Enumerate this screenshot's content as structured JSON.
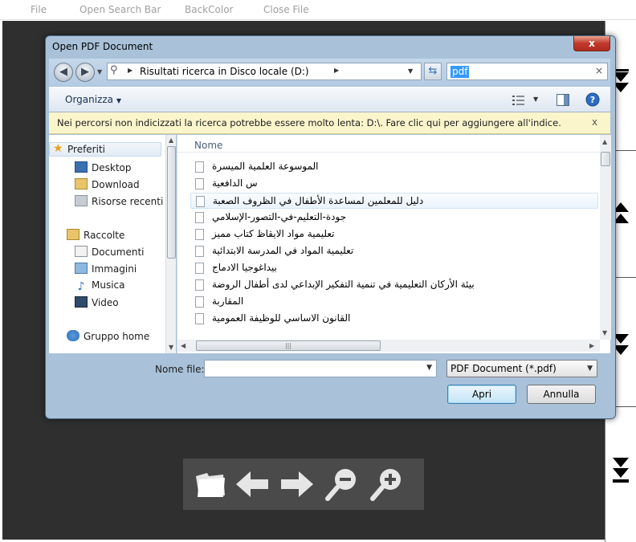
{
  "menu": {
    "items": [
      "File",
      "Open Search Bar",
      "BackColor",
      "Close File"
    ]
  },
  "dialog": {
    "title": "Open PDF Document",
    "close_label": "x",
    "address": "Risultati ricerca in Disco locale (D:)",
    "search_value": "pdf",
    "organize_label": "Organizza",
    "info_text": "Nei percorsi non indicizzati la ricerca potrebbe essere molto lenta: D:\\. Fare clic qui per aggiungere all'indice.",
    "info_close": "x",
    "nav": {
      "favorites": "Preferiti",
      "desktop": "Desktop",
      "download": "Download",
      "recent": "Risorse recenti",
      "libraries": "Raccolte",
      "documents": "Documenti",
      "images": "Immagini",
      "music": "Musica",
      "video": "Video",
      "homegroup": "Gruppo home"
    },
    "column_name": "Nome",
    "files": [
      "الموسوعة العلمية الميسرة",
      "س الدافعية",
      "دليل للمعلمين لمساعدة الأطفال في الظروف الصعبة",
      "جودة-التعليم-في-التصور-الإسلامي",
      "تعليمية مواد الايقاظ كتاب مميز",
      "تعليمية المواد في المدرسة الابتدائية",
      "بيداغوجيا الادماج",
      "بيئة الأركان التعليمية في تنمية التفكير الإبداعي لدى أطفال الروضة",
      "المقاربة",
      "القانون الاساسي للوظيفة العمومية"
    ],
    "filename_label": "Nome file:",
    "filename_value": "",
    "filetype": "PDF Document (*.pdf)",
    "open_label": "Apri",
    "cancel_label": "Annulla"
  }
}
